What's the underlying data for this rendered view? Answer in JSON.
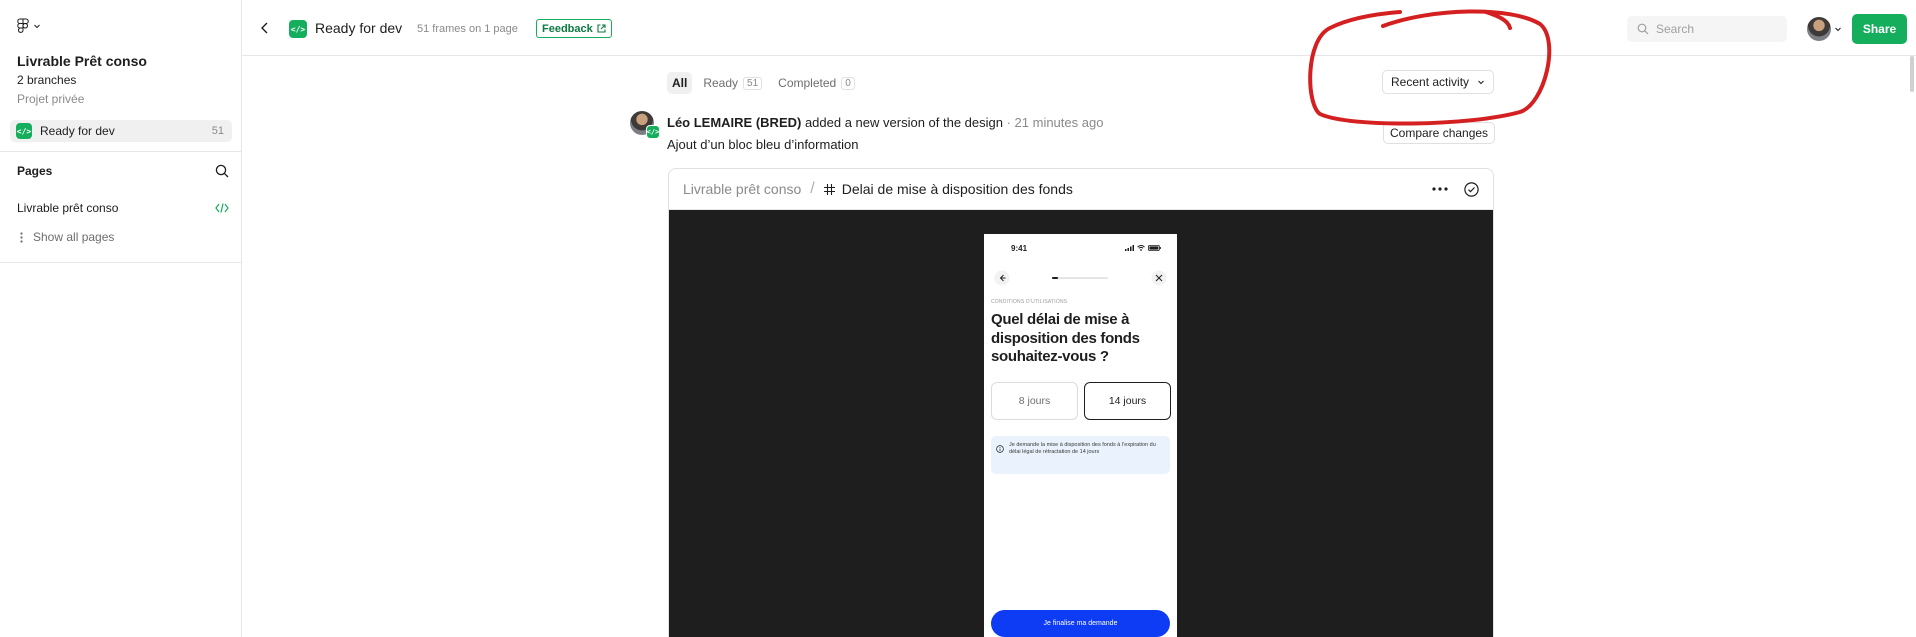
{
  "sidebar": {
    "project_title": "Livrable Prêt conso",
    "branches": "2 branches",
    "project_subtitle": "Projet privée",
    "ready_item": {
      "label": "Ready for dev",
      "count": "51"
    },
    "pages_heading": "Pages",
    "pages": [
      {
        "label": "Livrable prêt conso"
      }
    ],
    "show_all": "Show all pages"
  },
  "topbar": {
    "title": "Ready for dev",
    "frames_info": "51 frames on 1 page",
    "feedback_label": "Feedback",
    "search_placeholder": "Search",
    "share_label": "Share"
  },
  "filters": {
    "tabs": [
      {
        "label": "All",
        "count": ""
      },
      {
        "label": "Ready",
        "count": "51"
      },
      {
        "label": "Completed",
        "count": "0"
      }
    ],
    "sort_label": "Recent activity"
  },
  "activity": {
    "author": "Léo LEMAIRE (BRED)",
    "action": " added a new version of the design",
    "time": " · 21 minutes ago",
    "description": "Ajout d’un bloc bleu d’information",
    "compare_label": "Compare changes"
  },
  "frame_card": {
    "page_crumb": "Livrable prêt conso",
    "separator": "/",
    "frame_name": "Delai de mise à disposition des fonds"
  },
  "phone": {
    "time": "9:41",
    "progress_fraction": 0.1,
    "section_label": "CONDITIONS D’UTILISATIONS",
    "question": "Quel délai de mise à disposition des fonds souhaitez-vous ?",
    "options": [
      {
        "label": "8 jours",
        "selected": false
      },
      {
        "label": "14 jours",
        "selected": true
      }
    ],
    "info_text": "Je demande la mise à disposition des fonds à l’expiration du délai légal de rétractation de 14 jours",
    "cta_label": "Je finalise ma demande"
  },
  "colors": {
    "dev_green": "#14ae5c",
    "cta_blue": "#0e3cf5",
    "canvas_bg": "#1e1e1e",
    "annotation_red": "#d42020"
  }
}
